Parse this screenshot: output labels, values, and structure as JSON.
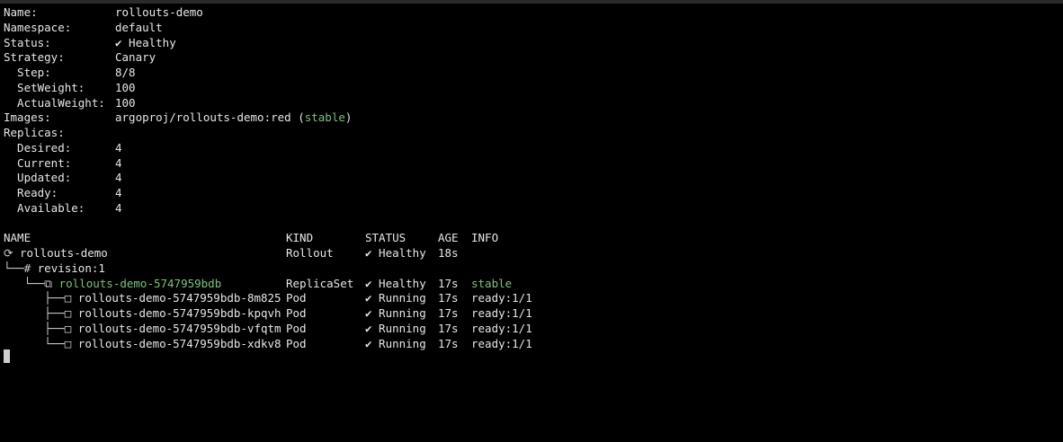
{
  "summary": [
    {
      "key": "Name:",
      "value": "rollouts-demo"
    },
    {
      "key": "Namespace:",
      "value": "default"
    },
    {
      "key": "Status:",
      "value": "✔ Healthy"
    },
    {
      "key": "Strategy:",
      "value": "Canary"
    },
    {
      "key": "  Step:",
      "value": "8/8"
    },
    {
      "key": "  SetWeight:",
      "value": "100"
    },
    {
      "key": "  ActualWeight:",
      "value": "100"
    },
    {
      "key": "Images:",
      "value": "argoproj/rollouts-demo:red",
      "suffix_open": " (",
      "suffix_tag": "stable",
      "suffix_close": ")"
    },
    {
      "key": "Replicas:",
      "value": ""
    },
    {
      "key": "  Desired:",
      "value": "4"
    },
    {
      "key": "  Current:",
      "value": "4"
    },
    {
      "key": "  Updated:",
      "value": "4"
    },
    {
      "key": "  Ready:",
      "value": "4"
    },
    {
      "key": "  Available:",
      "value": "4"
    }
  ],
  "table": {
    "headers": {
      "name": "NAME",
      "kind": "KIND",
      "status": "STATUS",
      "age": "AGE",
      "info": "INFO"
    },
    "rows": [
      {
        "prefix": "⟳ ",
        "name": "rollouts-demo",
        "kind": "Rollout",
        "status": "✔ Healthy",
        "age": "18s",
        "info": ""
      },
      {
        "prefix": "└──# ",
        "name": "revision:1",
        "kind": "",
        "status": "",
        "age": "",
        "info": ""
      },
      {
        "prefix": "   └──⧉ ",
        "name": "rollouts-demo-5747959bdb",
        "kind": "ReplicaSet",
        "status": "✔ Healthy",
        "age": "17s",
        "info": "stable"
      },
      {
        "prefix": "      ├──□ ",
        "name": "rollouts-demo-5747959bdb-8m825",
        "kind": "Pod",
        "status": "✔ Running",
        "age": "17s",
        "info": "ready:1/1"
      },
      {
        "prefix": "      ├──□ ",
        "name": "rollouts-demo-5747959bdb-kpqvh",
        "kind": "Pod",
        "status": "✔ Running",
        "age": "17s",
        "info": "ready:1/1"
      },
      {
        "prefix": "      ├──□ ",
        "name": "rollouts-demo-5747959bdb-vfqtm",
        "kind": "Pod",
        "status": "✔ Running",
        "age": "17s",
        "info": "ready:1/1"
      },
      {
        "prefix": "      └──□ ",
        "name": "rollouts-demo-5747959bdb-xdkv8",
        "kind": "Pod",
        "status": "✔ Running",
        "age": "17s",
        "info": "ready:1/1"
      }
    ]
  },
  "colors": {
    "background": "#000000",
    "text": "#e6e6e6",
    "accent_green": "#7dc27d"
  }
}
